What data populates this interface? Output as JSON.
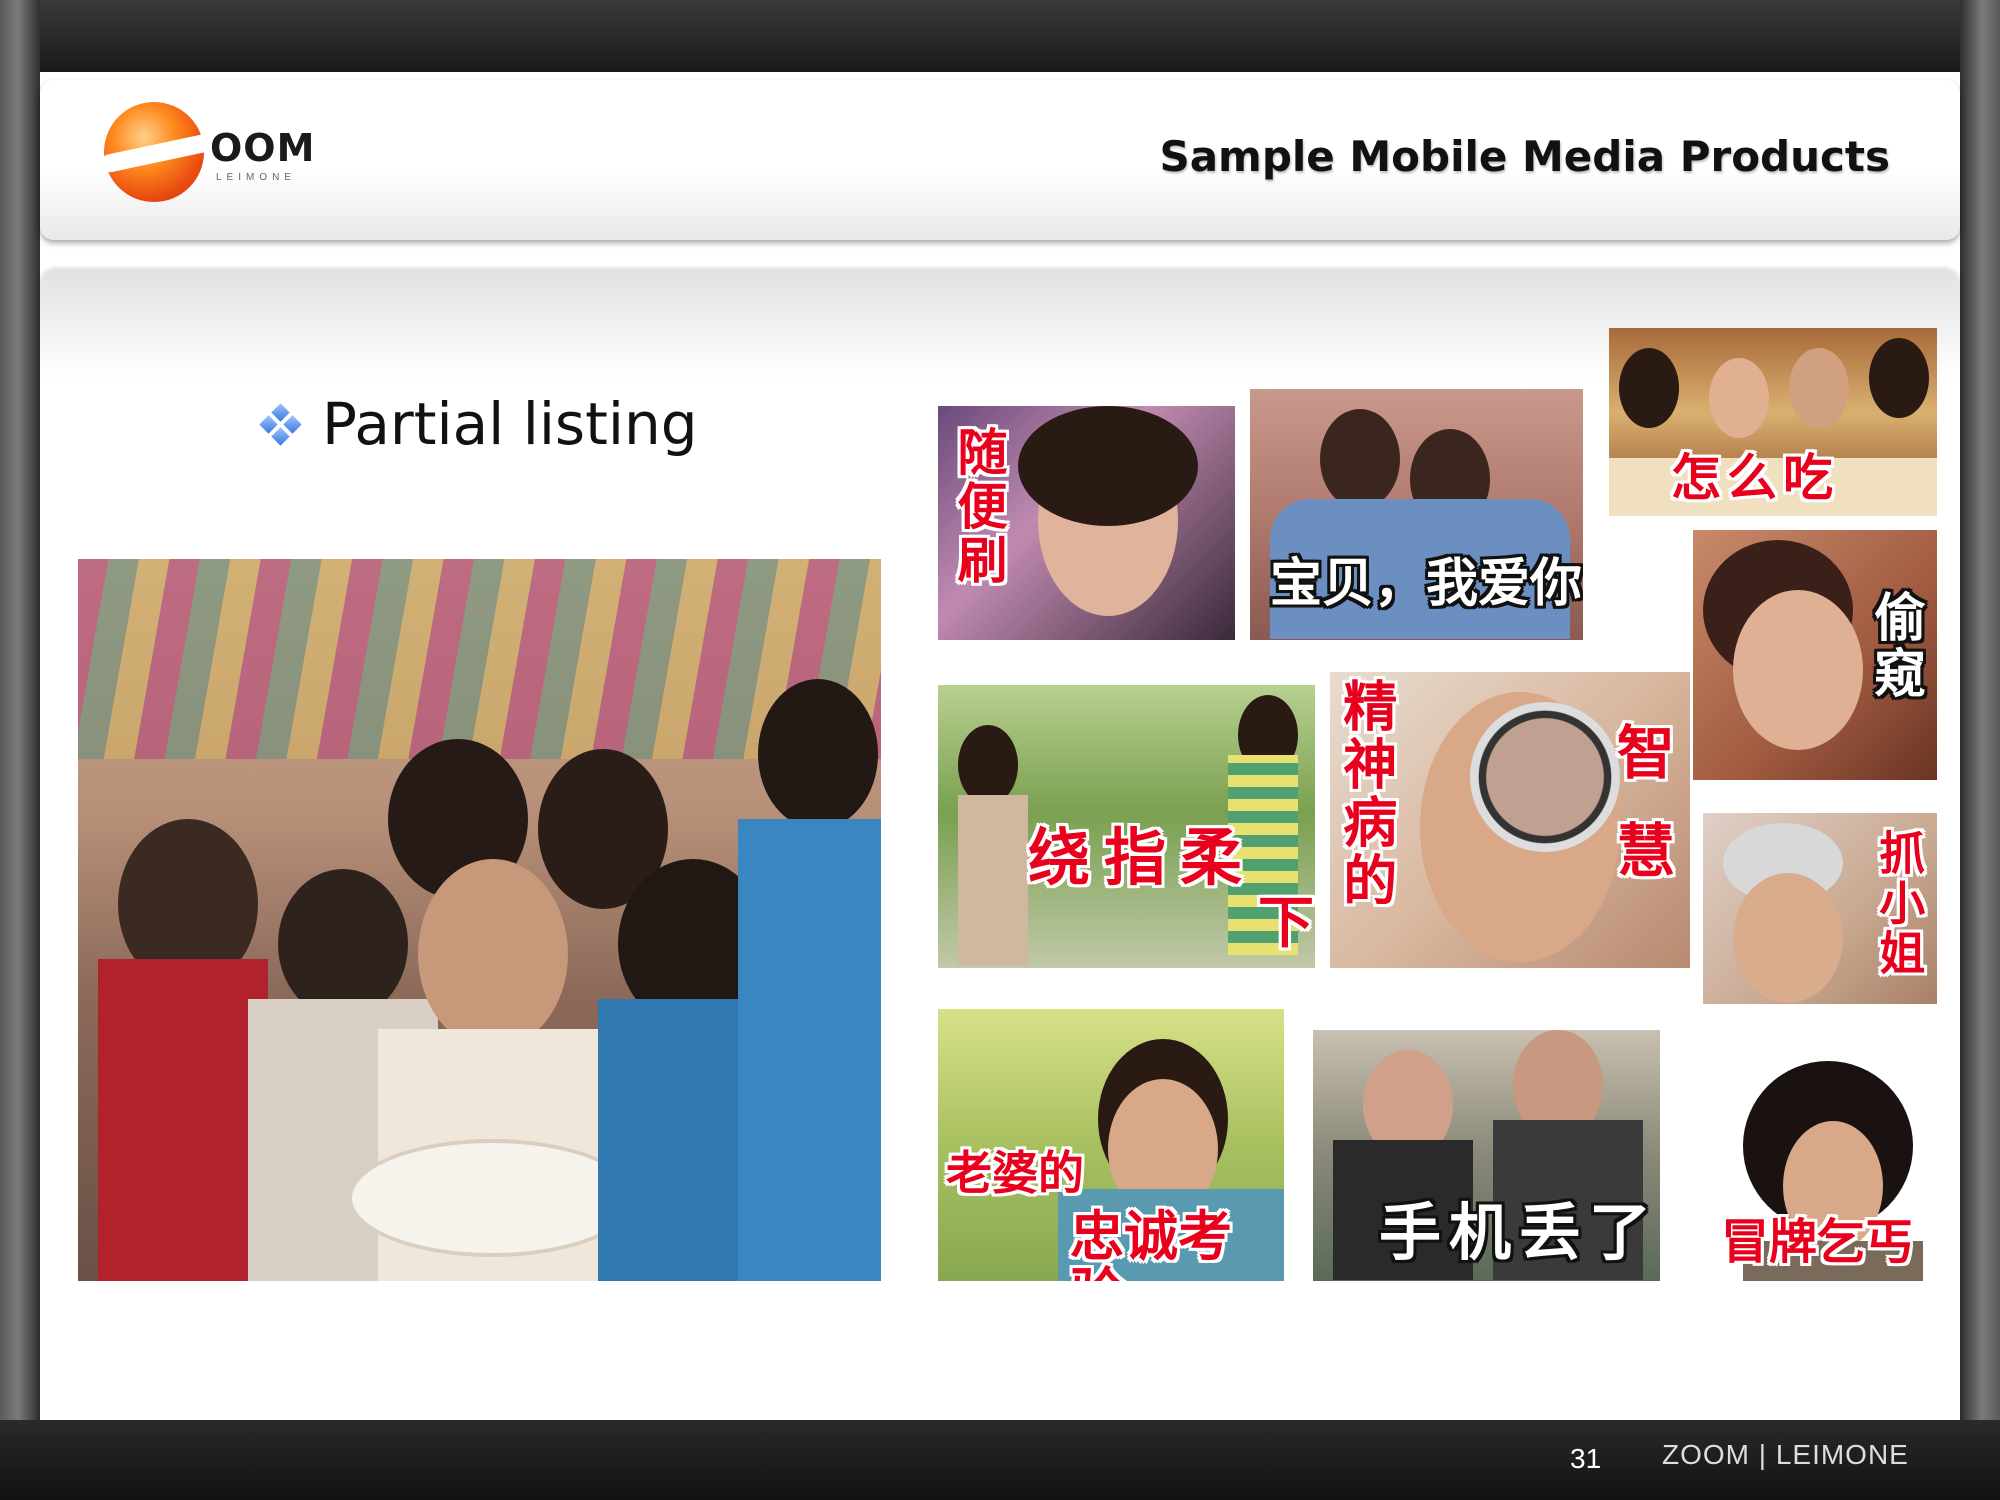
{
  "header": {
    "logo_text": "OOM",
    "logo_sub": "LEIMONE",
    "title": "Sample Mobile Media Products"
  },
  "content": {
    "bullet": "Partial listing"
  },
  "thumbnails": [
    {
      "id": "t1",
      "caption": "随便刷"
    },
    {
      "id": "t2",
      "caption": "宝贝，我爱你"
    },
    {
      "id": "t3",
      "caption": "怎么吃"
    },
    {
      "id": "t4",
      "caption": "偷窥"
    },
    {
      "id": "t5",
      "caption_a": "绕指柔",
      "caption_b": "下"
    },
    {
      "id": "t6",
      "caption_a": "精神病的",
      "caption_b": "智慧"
    },
    {
      "id": "t7",
      "caption": "抓小姐"
    },
    {
      "id": "t8",
      "caption_a": "老婆的",
      "caption_b": "忠诚考验"
    },
    {
      "id": "t9",
      "caption": "手机丢了"
    },
    {
      "id": "t10",
      "caption": "冒牌乞丐"
    }
  ],
  "footer": {
    "page_number": "31",
    "brand": "ZOOM  |  LEIMONE"
  },
  "colors": {
    "caption_red": "#e8001c",
    "bullet_blue": "#3a78e0",
    "logo_orange": "#ff8a1e"
  }
}
